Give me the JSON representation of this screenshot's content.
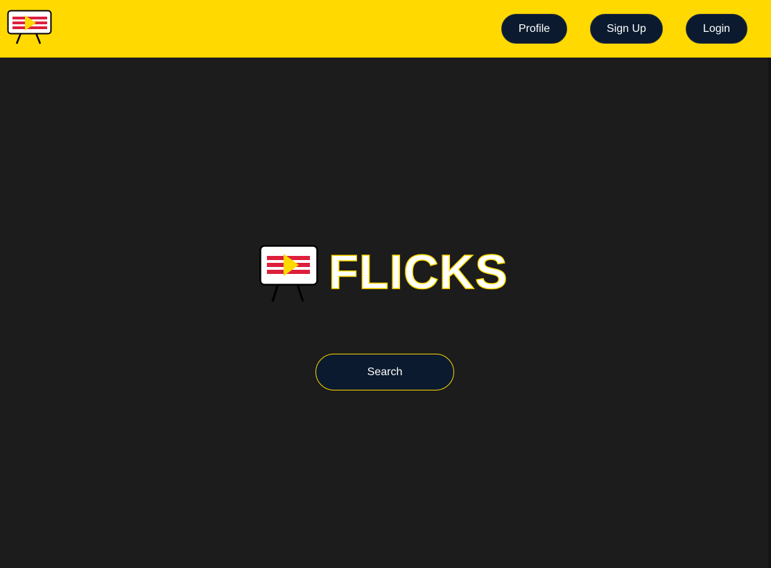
{
  "header": {
    "logo_icon": "flicks-easel-screen-icon",
    "nav": {
      "profile_label": "Profile",
      "signup_label": "Sign Up",
      "login_label": "Login"
    }
  },
  "hero": {
    "logo_icon": "flicks-easel-screen-icon",
    "title": "FLICKS",
    "search_label": "Search"
  },
  "colors": {
    "header_bg": "#ffd900",
    "page_bg": "#1c1c1c",
    "button_bg": "#0b1a2e",
    "accent": "#ffd900",
    "logo_red": "#dd1f3c"
  }
}
